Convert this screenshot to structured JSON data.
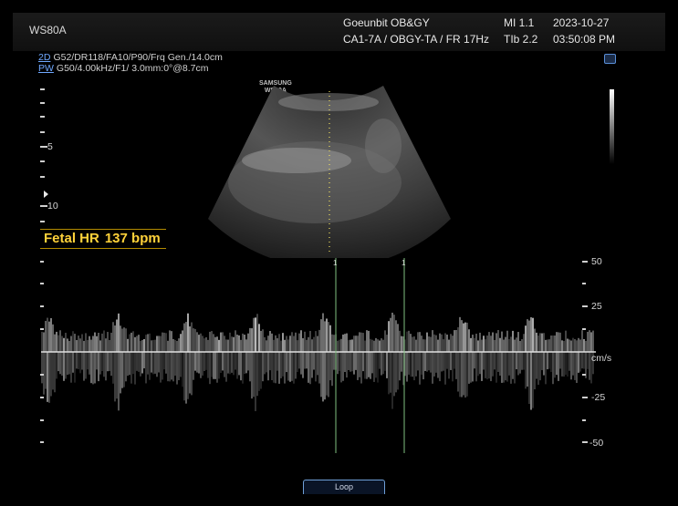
{
  "header": {
    "model": "WS80A",
    "hospital": "Goeunbit OB&GY",
    "preset": "CA1-7A / OBGY-TA / FR 17Hz",
    "mi": "MI  1.1",
    "tib": "TIb 2.2",
    "date": "2023-10-27",
    "time": "03:50:08 PM"
  },
  "params": {
    "mode_2d": "2D",
    "line_2d": "G52/DR118/FA10/P90/Frq Gen./14.0cm",
    "mode_pw": "PW",
    "line_pw": "G50/4.00kHz/F1/ 3.0mm:0°@8.7cm"
  },
  "probe_logo": {
    "line1": "SAMSUNG",
    "line2": "WS80A"
  },
  "depth_scale": {
    "marks": [
      "5",
      "10"
    ]
  },
  "measurement": {
    "label": "Fetal HR",
    "value": "137 bpm"
  },
  "cursor_labels": [
    "1",
    "1"
  ],
  "velocity_scale": {
    "ticks": [
      "50",
      "25",
      "cm/s",
      "-25",
      "-50"
    ]
  },
  "controls": {
    "loop_button": "Loop"
  },
  "colors": {
    "hr_text": "#ffd23a",
    "mode_link": "#6fa8ff",
    "cursor_line": "#7fbf7f"
  }
}
